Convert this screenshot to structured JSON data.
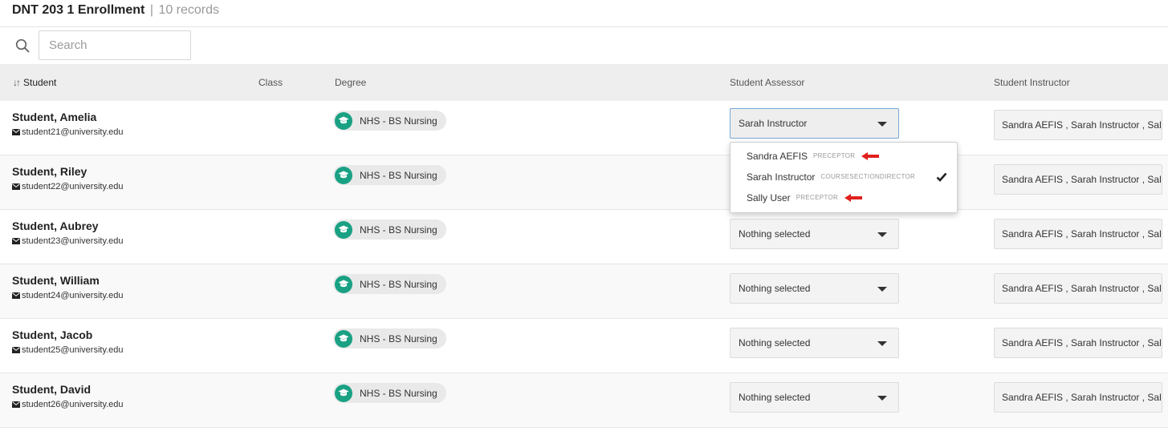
{
  "header": {
    "title": "DNT 203 1 Enrollment",
    "separator": "|",
    "count": "10 records"
  },
  "search": {
    "placeholder": "Search",
    "value": "",
    "icon": "search-icon"
  },
  "table": {
    "columns": {
      "student": "Student",
      "class": "Class",
      "degree": "Degree",
      "assessor": "Student Assessor",
      "instructor": "Student Instructor"
    },
    "sort_icon": "↓↑",
    "rows": [
      {
        "name": "Student, Amelia",
        "email": "student21@university.edu",
        "class": "",
        "degree": "NHS - BS Nursing",
        "assessor": "Sarah Instructor",
        "instructors": "Sandra AEFIS , Sarah Instructor , Sally User"
      },
      {
        "name": "Student, Riley",
        "email": "student22@university.edu",
        "class": "",
        "degree": "NHS - BS Nursing",
        "assessor": "Nothing selected",
        "instructors": "Sandra AEFIS , Sarah Instructor , Sally User"
      },
      {
        "name": "Student, Aubrey",
        "email": "student23@university.edu",
        "class": "",
        "degree": "NHS - BS Nursing",
        "assessor": "Nothing selected",
        "instructors": "Sandra AEFIS , Sarah Instructor , Sally User"
      },
      {
        "name": "Student, William",
        "email": "student24@university.edu",
        "class": "",
        "degree": "NHS - BS Nursing",
        "assessor": "Nothing selected",
        "instructors": "Sandra AEFIS , Sarah Instructor , Sally User"
      },
      {
        "name": "Student, Jacob",
        "email": "student25@university.edu",
        "class": "",
        "degree": "NHS - BS Nursing",
        "assessor": "Nothing selected",
        "instructors": "Sandra AEFIS , Sarah Instructor , Sally User"
      },
      {
        "name": "Student, David",
        "email": "student26@university.edu",
        "class": "",
        "degree": "NHS - BS Nursing",
        "assessor": "Nothing selected",
        "instructors": "Sandra AEFIS , Sarah Instructor , Sally User"
      }
    ]
  },
  "dropdown": {
    "open_for_row": 0,
    "options": [
      {
        "name": "Sandra AEFIS",
        "role": "PRECEPTOR",
        "selected": false,
        "annotated": true
      },
      {
        "name": "Sarah Instructor",
        "role": "COURSESECTIONDIRECTOR",
        "selected": true,
        "annotated": false
      },
      {
        "name": "Sally User",
        "role": "PRECEPTOR",
        "selected": false,
        "annotated": true
      }
    ]
  },
  "colors": {
    "degree_icon": "#1aa184",
    "annotation_arrow": "#e0201e",
    "header_bg": "#eeeeee",
    "focus_border": "#7aa7d8"
  },
  "icons": {
    "mail": "envelope-icon",
    "degree": "graduation-cap-icon",
    "caret": "caret-down-icon",
    "check": "check-icon",
    "annotation": "red-arrow-icon"
  }
}
